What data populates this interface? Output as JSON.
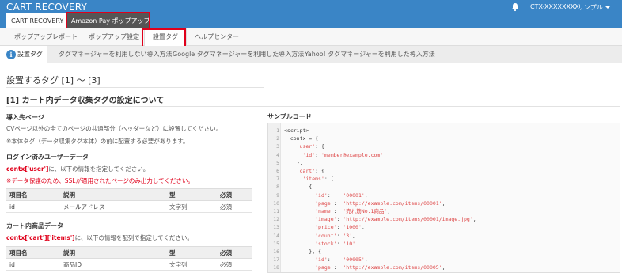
{
  "app": {
    "title": "CART RECOVERY",
    "account": "CTX-XXXXXXXX",
    "user_menu": "サンプル"
  },
  "top_tabs": [
    {
      "label": "CART RECOVERY"
    },
    {
      "label": "Amazon Pay ポップアップ"
    }
  ],
  "sub_nav": [
    {
      "label": "ポップアップレポート"
    },
    {
      "label": "ポップアップ設定"
    },
    {
      "label": "設置タグ"
    },
    {
      "label": "ヘルプセンター"
    }
  ],
  "tag_tabs": [
    {
      "label": "設置タグ"
    },
    {
      "label": "タグマネージャーを利用しない導入方法"
    },
    {
      "label": "Google タグマネージャーを利用した導入方法"
    },
    {
      "label": "Yahoo! タグマネージャーを利用した導入方法"
    }
  ],
  "content": {
    "h1": "設置するタグ [1] 〜 [3]",
    "h2": "[1] カート内データ収集タグの設定について",
    "sec1_title": "導入先ページ",
    "sec1_line1": "CVページ以外の全てのページの共通部分（ヘッダーなど）に設置してください。",
    "sec1_line2": "※本体タグ（データ収集タグ本体）の前に配置する必要があります。",
    "sec2_title": "ログイン済みユーザーデータ",
    "sec2_code": "contx['user']",
    "sec2_rest": "に、以下の情報を指定してください。",
    "sec2_warn": "※データ保護のため、SSLが適用されたページのみ出力してください。",
    "table_headers": {
      "name": "項目名",
      "desc": "説明",
      "type": "型",
      "req": "必須"
    },
    "user_row": {
      "name": "id",
      "desc": "メールアドレス",
      "type": "文字列",
      "req": "必須"
    },
    "sec3_title": "カート内商品データ",
    "sec3_code": "contx['cart']['items']",
    "sec3_rest": "に、以下の情報を配列で指定してください。",
    "item_row": {
      "name": "id",
      "desc": "商品ID",
      "type": "文字列",
      "req": "必須"
    }
  },
  "code": {
    "title": "サンプルコード",
    "lines": [
      {
        "n": "1",
        "t": "<script>"
      },
      {
        "n": "2",
        "t": "  contx = {"
      },
      {
        "n": "3",
        "t": "    'user': {"
      },
      {
        "n": "4",
        "t": "      'id': 'member@example.com'"
      },
      {
        "n": "5",
        "t": "    },"
      },
      {
        "n": "6",
        "t": "    'cart': {"
      },
      {
        "n": "7",
        "t": "      'items': ["
      },
      {
        "n": "8",
        "t": "        {"
      },
      {
        "n": "9",
        "t": "          'id':    '00001',"
      },
      {
        "n": "10",
        "t": "          'page':  'http://example.com/items/00001',"
      },
      {
        "n": "11",
        "t": "          'name':  '売れ筋No.1商品',"
      },
      {
        "n": "12",
        "t": "          'image': 'http://example.com/items/00001/image.jpg',"
      },
      {
        "n": "13",
        "t": "          'price': '1000',"
      },
      {
        "n": "14",
        "t": "          'count': '3',"
      },
      {
        "n": "15",
        "t": "          'stock': '10'"
      },
      {
        "n": "16",
        "t": "        }, {"
      },
      {
        "n": "17",
        "t": "          'id':    '00005',"
      },
      {
        "n": "18",
        "t": "          'page':  'http://example.com/items/00005',"
      }
    ]
  },
  "colors": {
    "brand_blue": "#3a85c6",
    "highlight_red": "#e0001b",
    "dark_tab": "#555555"
  }
}
